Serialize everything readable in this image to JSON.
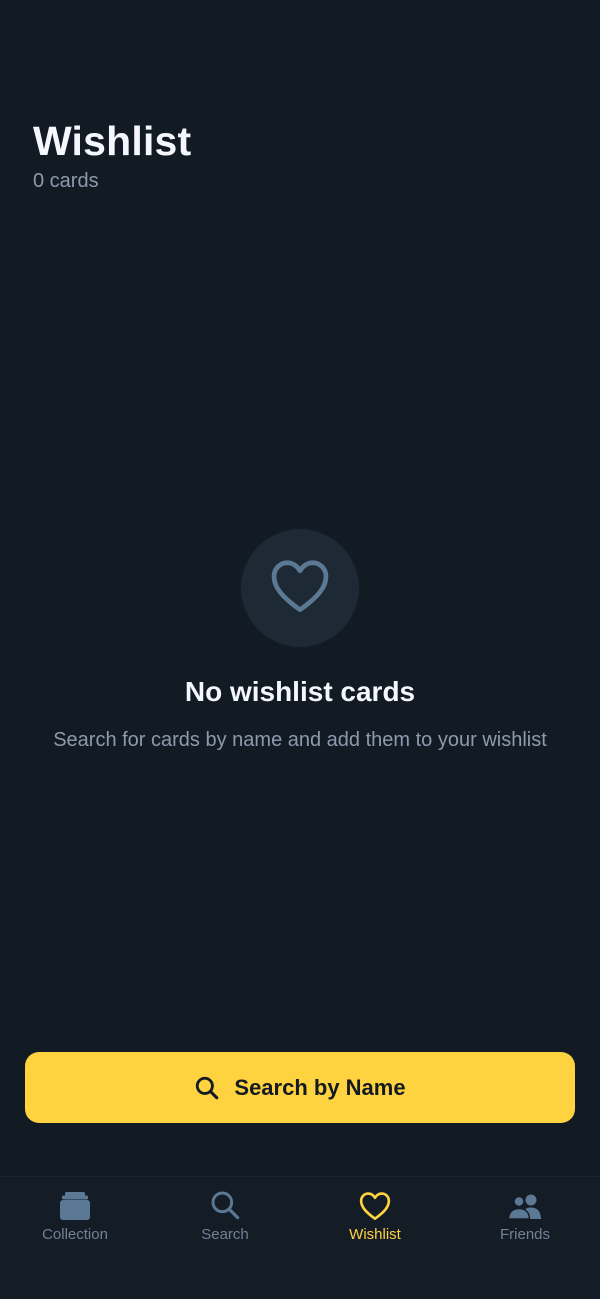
{
  "header": {
    "title": "Wishlist",
    "subtitle": "0 cards"
  },
  "empty_state": {
    "icon": "heart-icon",
    "title": "No wishlist cards",
    "description": "Search for cards by name and add them to your wishlist"
  },
  "primary_action": {
    "label": "Search by Name",
    "icon": "search-icon"
  },
  "bottom_nav": {
    "items": [
      {
        "label": "Collection",
        "icon": "cards-stack-icon",
        "active": false
      },
      {
        "label": "Search",
        "icon": "search-icon",
        "active": false
      },
      {
        "label": "Wishlist",
        "icon": "heart-icon",
        "active": true
      },
      {
        "label": "Friends",
        "icon": "friends-icon",
        "active": false
      }
    ]
  },
  "colors": {
    "background": "#121a24",
    "accent": "#ffd23f",
    "muted_text": "#8d9aac",
    "nav_inactive": "#6f8296",
    "icon_muted": "#5b7894"
  }
}
